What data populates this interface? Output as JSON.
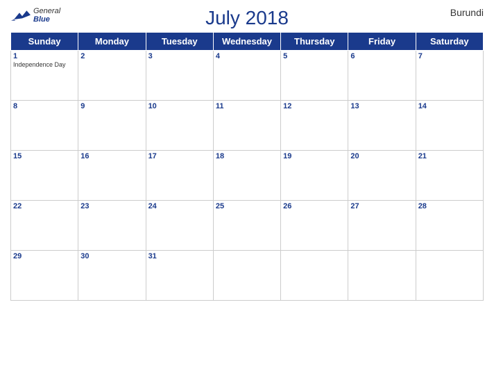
{
  "header": {
    "title": "July 2018",
    "country": "Burundi",
    "logo": {
      "general": "General",
      "blue": "Blue"
    }
  },
  "weekdays": [
    "Sunday",
    "Monday",
    "Tuesday",
    "Wednesday",
    "Thursday",
    "Friday",
    "Saturday"
  ],
  "weeks": [
    [
      {
        "day": 1,
        "holiday": "Independence Day"
      },
      {
        "day": 2
      },
      {
        "day": 3
      },
      {
        "day": 4
      },
      {
        "day": 5
      },
      {
        "day": 6
      },
      {
        "day": 7
      }
    ],
    [
      {
        "day": 8
      },
      {
        "day": 9
      },
      {
        "day": 10
      },
      {
        "day": 11
      },
      {
        "day": 12
      },
      {
        "day": 13
      },
      {
        "day": 14
      }
    ],
    [
      {
        "day": 15
      },
      {
        "day": 16
      },
      {
        "day": 17
      },
      {
        "day": 18
      },
      {
        "day": 19
      },
      {
        "day": 20
      },
      {
        "day": 21
      }
    ],
    [
      {
        "day": 22
      },
      {
        "day": 23
      },
      {
        "day": 24
      },
      {
        "day": 25
      },
      {
        "day": 26
      },
      {
        "day": 27
      },
      {
        "day": 28
      }
    ],
    [
      {
        "day": 29
      },
      {
        "day": 30
      },
      {
        "day": 31
      },
      {
        "day": null
      },
      {
        "day": null
      },
      {
        "day": null
      },
      {
        "day": null
      }
    ]
  ],
  "colors": {
    "header_bg": "#1a3a8c",
    "header_text": "#ffffff",
    "title_color": "#1a3a8c",
    "day_number_color": "#1a3a8c"
  }
}
